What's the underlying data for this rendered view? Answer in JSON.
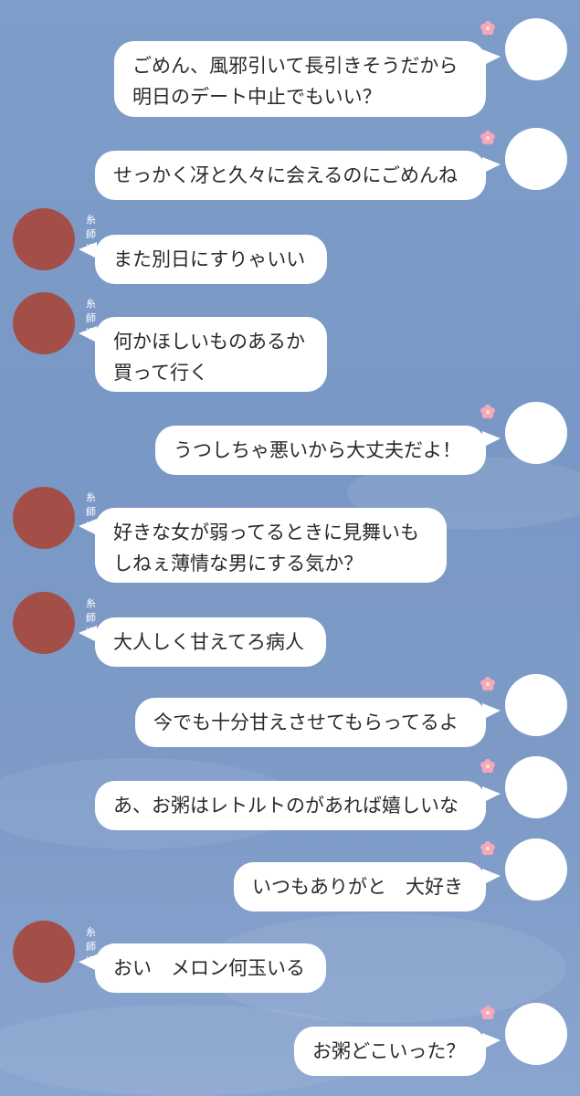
{
  "sender_name": "糸師冴",
  "colors": {
    "background": "#7f9dc9",
    "bubble": "#ffffff",
    "other_avatar": "#a34f48",
    "self_avatar": "#ffffff",
    "flower": "#f7a6c0"
  },
  "messages": [
    {
      "from": "self",
      "text": "ごめん、風邪引いて長引きそうだから\n明日のデート中止でもいい？"
    },
    {
      "from": "self",
      "text": "せっかく冴と久々に会えるのにごめんね"
    },
    {
      "from": "other",
      "text": "また別日にすりゃいい"
    },
    {
      "from": "other",
      "text": "何かほしいものあるか\n買って行く"
    },
    {
      "from": "self",
      "text": "うつしちゃ悪いから大丈夫だよ！"
    },
    {
      "from": "other",
      "text": "好きな女が弱ってるときに見舞いも\nしねぇ薄情な男にする気か？"
    },
    {
      "from": "other",
      "text": "大人しく甘えてろ病人"
    },
    {
      "from": "self",
      "text": "今でも十分甘えさせてもらってるよ"
    },
    {
      "from": "self",
      "text": "あ、お粥はレトルトのがあれば嬉しいな"
    },
    {
      "from": "self",
      "text": "いつもありがと　大好き"
    },
    {
      "from": "other",
      "text": "おい　メロン何玉いる"
    },
    {
      "from": "self",
      "text": "お粥どこいった？"
    }
  ]
}
